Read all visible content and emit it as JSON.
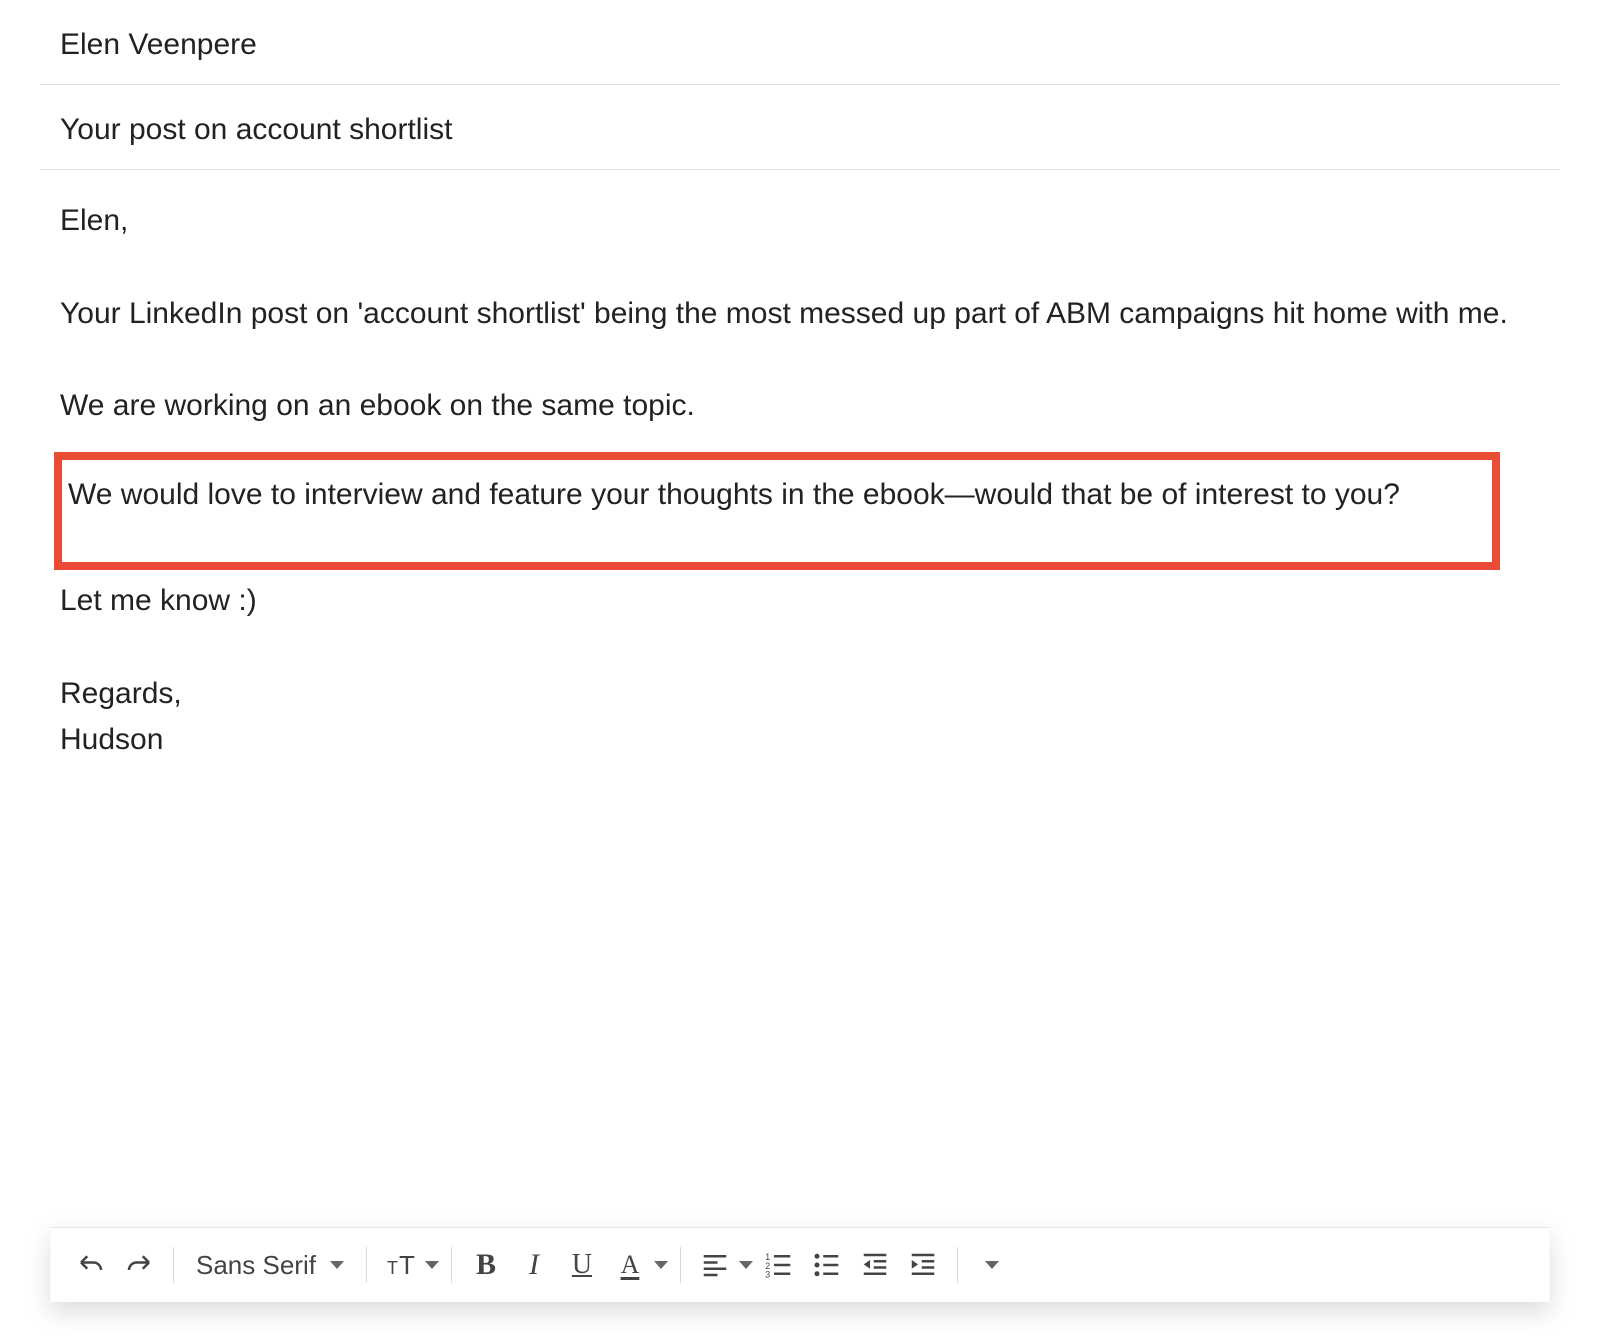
{
  "to": "Elen Veenpere",
  "subject": "Your post on account shortlist",
  "body": {
    "greeting": "Elen,",
    "para1": "Your LinkedIn post on 'account shortlist' being the most messed up part of ABM campaigns hit home with me.",
    "para2": "We are working on an ebook on the same topic.",
    "highlighted": "We would love to interview and feature your thoughts in the ebook—would that be of interest to you?",
    "para3": "Let me know :)",
    "closing1": "Regards,",
    "closing2": "Hudson"
  },
  "toolbar": {
    "font_family": "Sans Serif"
  }
}
